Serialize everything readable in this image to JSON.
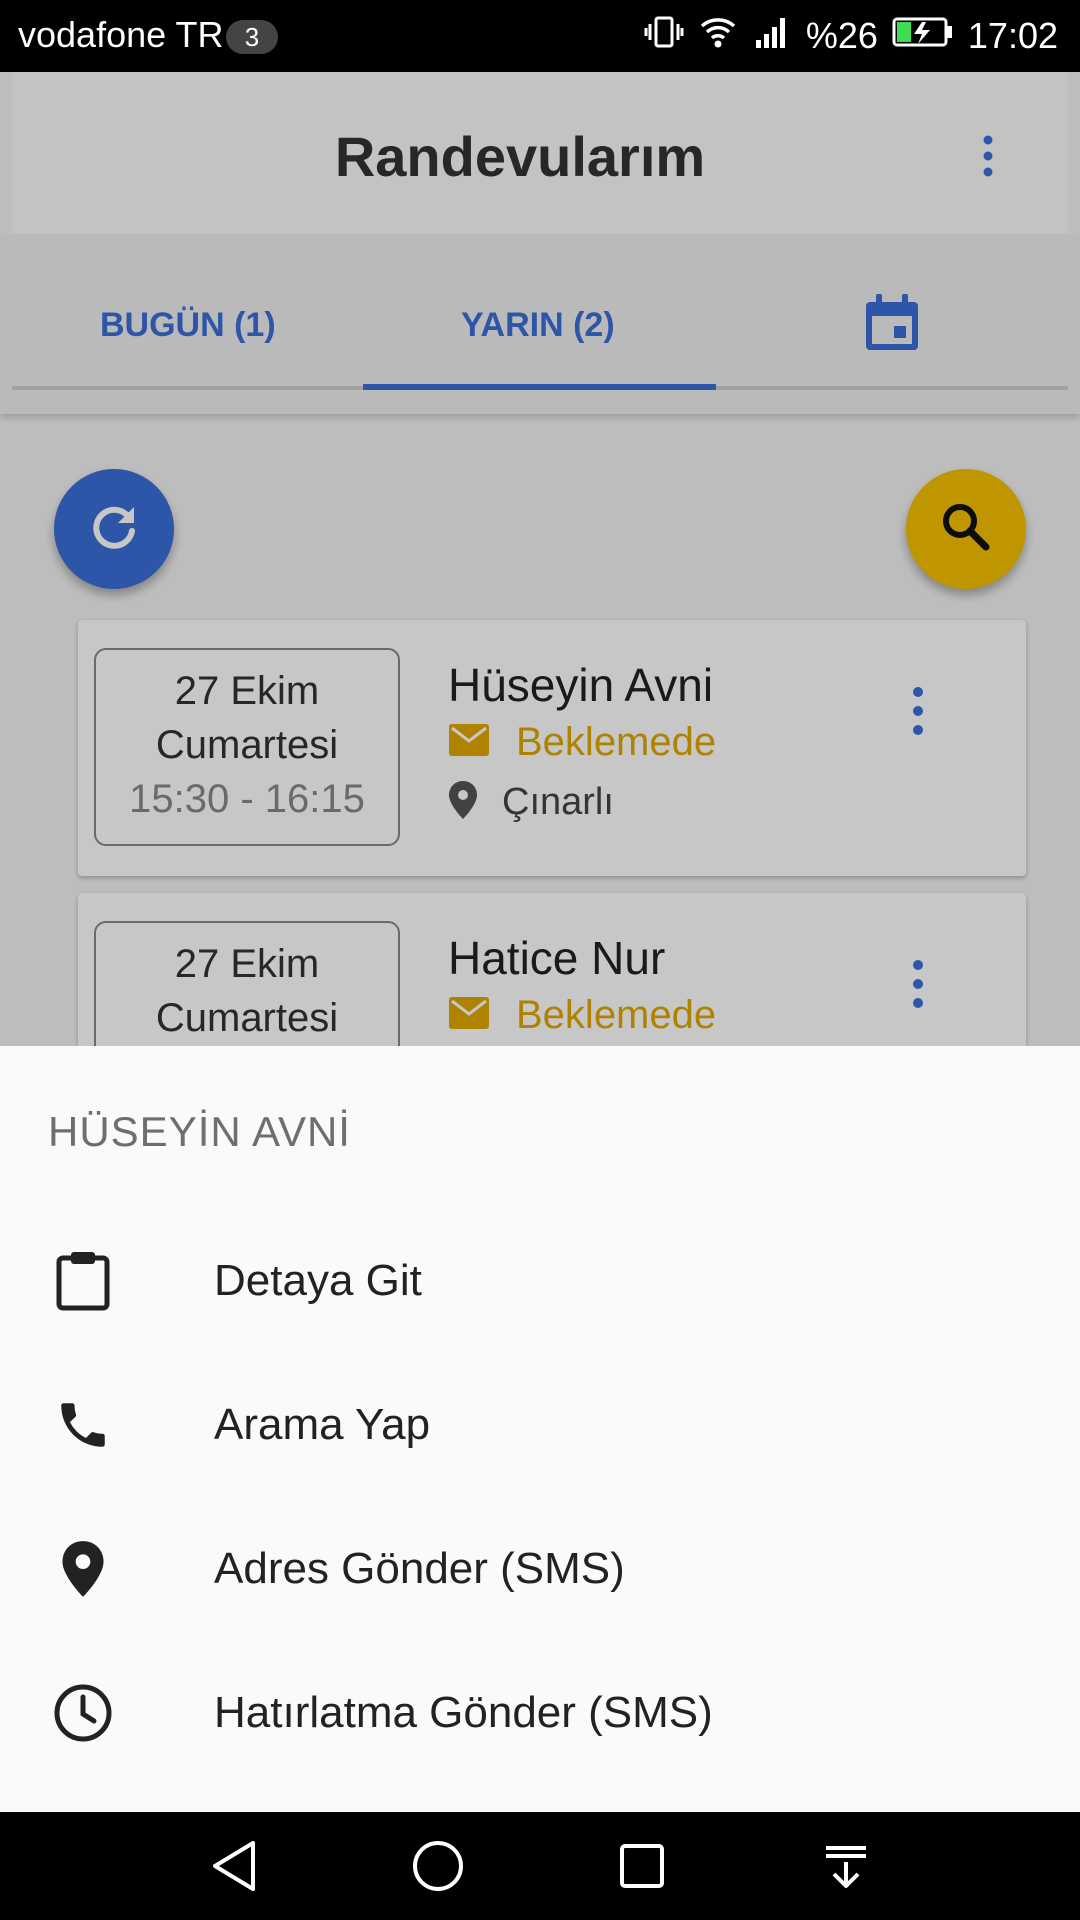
{
  "status_bar": {
    "carrier": "vodafone TR",
    "sim_badge": "3",
    "battery": "%26",
    "time": "17:02",
    "icons": [
      "vibrate-icon",
      "wifi-icon",
      "signal-icon",
      "battery-charging-icon"
    ]
  },
  "app_bar": {
    "title": "Randevularım",
    "menu_icon": "more-vert-icon"
  },
  "tabs": [
    {
      "label": "BUGÜN (1)",
      "selected": false
    },
    {
      "label": "YARIN (2)",
      "selected": true
    },
    {
      "icon": "calendar-icon",
      "selected": false
    }
  ],
  "fabs": {
    "refresh_icon": "refresh-icon",
    "search_icon": "search-icon"
  },
  "appointments": [
    {
      "date": "27 Ekim",
      "day": "Cumartesi",
      "time": "15:30 - 16:15",
      "name": "Hüseyin Avni",
      "status": "Beklemede",
      "location": "Çınarlı"
    },
    {
      "date": "27 Ekim",
      "day": "Cumartesi",
      "name": "Hatice Nur",
      "status": "Beklemede"
    }
  ],
  "bottom_sheet": {
    "title": "HÜSEYİN AVNİ",
    "items": [
      {
        "label": "Detaya Git",
        "icon": "clipboard-icon"
      },
      {
        "label": "Arama Yap",
        "icon": "phone-icon"
      },
      {
        "label": "Adres Gönder (SMS)",
        "icon": "location-pin-icon"
      },
      {
        "label": "Hatırlatma Gönder (SMS)",
        "icon": "clock-icon"
      }
    ]
  },
  "colors": {
    "accent": "#3a6fd8",
    "search_fab": "#f5c000",
    "status_pending": "#e0a800"
  }
}
